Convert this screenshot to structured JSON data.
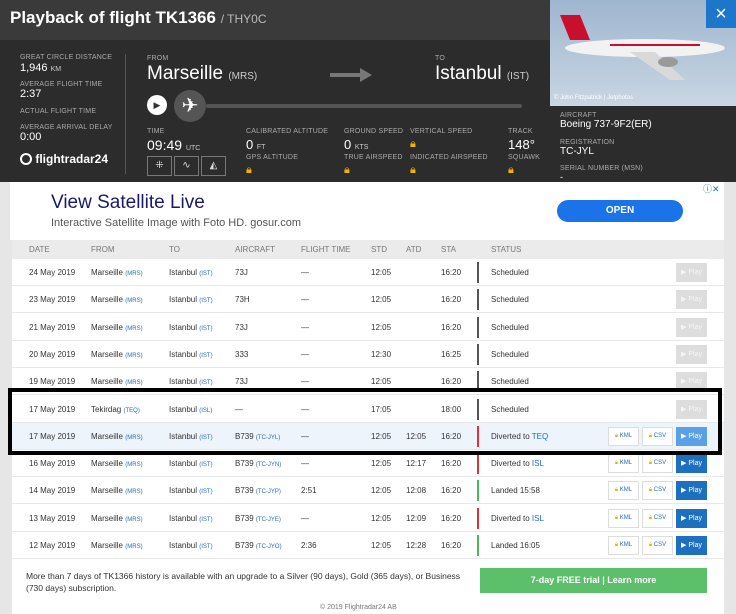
{
  "header": {
    "title": "Playback of flight TK1366",
    "callsign": "/ THY0C",
    "great_circle_label": "GREAT CIRCLE DISTANCE",
    "great_circle_value": "1,946",
    "great_circle_unit": "KM",
    "avg_flight_time_label": "AVERAGE FLIGHT TIME",
    "avg_flight_time_value": "2:37",
    "actual_flight_time_label": "ACTUAL FLIGHT TIME",
    "avg_arrival_delay_label": "AVERAGE ARRIVAL DELAY",
    "avg_arrival_delay_value": "0:00",
    "logo": "flightradar24",
    "from_label": "FROM",
    "from_city": "Marseille",
    "from_code": "(MRS)",
    "to_label": "TO",
    "to_city": "Istanbul",
    "to_code": "(IST)",
    "time_label": "TIME",
    "time_value": "09:49",
    "time_unit": "UTC",
    "cal_alt_label": "CALIBRATED ALTITUDE",
    "cal_alt_value": "0",
    "cal_alt_unit": "FT",
    "gps_alt_label": "GPS ALTITUDE",
    "ground_speed_label": "GROUND SPEED",
    "ground_speed_value": "0",
    "ground_speed_unit": "KTS",
    "true_airspeed_label": "TRUE AIRSPEED",
    "vertical_speed_label": "VERTICAL SPEED",
    "indicated_airspeed_label": "INDICATED AIRSPEED",
    "track_label": "TRACK",
    "track_value": "148°",
    "squawk_label": "SQUAWK",
    "aircraft_label": "AIRCRAFT",
    "aircraft_value": "Boeing 737-9F2(ER)",
    "registration_label": "REGISTRATION",
    "registration_value": "TC-JYL",
    "serial_label": "SERIAL NUMBER (MSN)",
    "serial_value": "-",
    "photo_credit": "© John Fitzpatrick | Jetphotos",
    "close_icon": "×"
  },
  "ad": {
    "title": "View Satellite Live",
    "subtitle": "Interactive Satellite Image with Foto HD. gosur.com",
    "button": "OPEN",
    "mark": "ⓘ✕"
  },
  "table": {
    "headers": {
      "date": "DATE",
      "from": "FROM",
      "to": "TO",
      "aircraft": "AIRCRAFT",
      "flight_time": "FLIGHT TIME",
      "std": "STD",
      "atd": "ATD",
      "sta": "STA",
      "status": "STATUS"
    },
    "rows": [
      {
        "date": "24 May 2019",
        "from": "Marseille",
        "from_code": "(MRS)",
        "to": "Istanbul",
        "to_code": "(IST)",
        "aircraft": "73J",
        "aircraft_reg": "",
        "flight_time": "—",
        "std": "12:05",
        "atd": "",
        "sta": "16:20",
        "status": "Scheduled",
        "status_link": ""
      },
      {
        "date": "23 May 2019",
        "from": "Marseille",
        "from_code": "(MRS)",
        "to": "Istanbul",
        "to_code": "(IST)",
        "aircraft": "73H",
        "aircraft_reg": "",
        "flight_time": "—",
        "std": "12:05",
        "atd": "",
        "sta": "16:20",
        "status": "Scheduled",
        "status_link": ""
      },
      {
        "date": "21 May 2019",
        "from": "Marseille",
        "from_code": "(MRS)",
        "to": "Istanbul",
        "to_code": "(IST)",
        "aircraft": "73J",
        "aircraft_reg": "",
        "flight_time": "—",
        "std": "12:05",
        "atd": "",
        "sta": "16:20",
        "status": "Scheduled",
        "status_link": ""
      },
      {
        "date": "20 May 2019",
        "from": "Marseille",
        "from_code": "(MRS)",
        "to": "Istanbul",
        "to_code": "(IST)",
        "aircraft": "333",
        "aircraft_reg": "",
        "flight_time": "—",
        "std": "12:30",
        "atd": "",
        "sta": "16:25",
        "status": "Scheduled",
        "status_link": ""
      },
      {
        "date": "19 May 2019",
        "from": "Marseille",
        "from_code": "(MRS)",
        "to": "Istanbul",
        "to_code": "(IST)",
        "aircraft": "73J",
        "aircraft_reg": "",
        "flight_time": "—",
        "std": "12:05",
        "atd": "",
        "sta": "16:20",
        "status": "Scheduled",
        "status_link": ""
      },
      {
        "date": "17 May 2019",
        "from": "Tekirdag",
        "from_code": "(TEQ)",
        "to": "Istanbul",
        "to_code": "(ISL)",
        "aircraft": "—",
        "aircraft_reg": "",
        "flight_time": "—",
        "std": "17:05",
        "atd": "",
        "sta": "18:00",
        "status": "Scheduled",
        "status_link": ""
      },
      {
        "date": "17 May 2019",
        "from": "Marseille",
        "from_code": "(MRS)",
        "to": "Istanbul",
        "to_code": "(IST)",
        "aircraft": "B739",
        "aircraft_reg": "(TC-JYL)",
        "flight_time": "—",
        "std": "12:05",
        "atd": "12:05",
        "sta": "16:20",
        "status": "Diverted to ",
        "status_link": "TEQ"
      },
      {
        "date": "16 May 2019",
        "from": "Marseille",
        "from_code": "(MRS)",
        "to": "Istanbul",
        "to_code": "(IST)",
        "aircraft": "B739",
        "aircraft_reg": "(TC-JYN)",
        "flight_time": "—",
        "std": "12:05",
        "atd": "12:17",
        "sta": "16:20",
        "status": "Diverted to ",
        "status_link": "ISL"
      },
      {
        "date": "14 May 2019",
        "from": "Marseille",
        "from_code": "(MRS)",
        "to": "Istanbul",
        "to_code": "(IST)",
        "aircraft": "B739",
        "aircraft_reg": "(TC-JYP)",
        "flight_time": "2:51",
        "std": "12:05",
        "atd": "12:08",
        "sta": "16:20",
        "status": "Landed 15:58",
        "status_link": ""
      },
      {
        "date": "13 May 2019",
        "from": "Marseille",
        "from_code": "(MRS)",
        "to": "Istanbul",
        "to_code": "(IST)",
        "aircraft": "B739",
        "aircraft_reg": "(TC-JYE)",
        "flight_time": "—",
        "std": "12:05",
        "atd": "12:09",
        "sta": "16:20",
        "status": "Diverted to ",
        "status_link": "ISL"
      },
      {
        "date": "12 May 2019",
        "from": "Marseille",
        "from_code": "(MRS)",
        "to": "Istanbul",
        "to_code": "(IST)",
        "aircraft": "B739",
        "aircraft_reg": "(TC-JYO)",
        "flight_time": "2:36",
        "std": "12:05",
        "atd": "12:28",
        "sta": "16:20",
        "status": "Landed 16:05",
        "status_link": ""
      }
    ],
    "kml_label": "KML",
    "csv_label": "CSV",
    "play_label": "▶ Play"
  },
  "footer": {
    "note": "More than 7 days of TK1366 history is available with an upgrade to a Silver (90 days), Gold (365 days), or Business (730 days) subscription.",
    "trial_button": "7-day FREE trial | Learn more",
    "copyright": "© 2019 Flightradar24 AB"
  },
  "colors": {
    "bar_scheduled": "#555555",
    "bar_diverted": "#e0303a",
    "bar_landed": "#4cb85a",
    "accent": "#1d6fc0"
  }
}
